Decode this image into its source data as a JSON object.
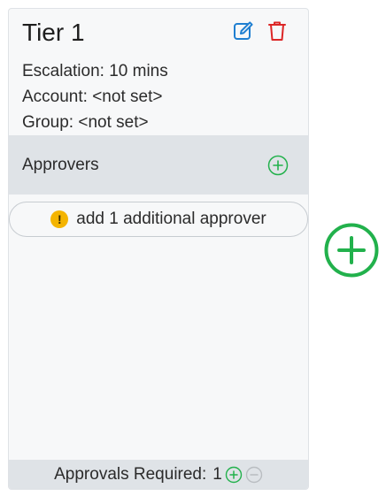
{
  "tier": {
    "title": "Tier 1",
    "escalation": "Escalation: 10 mins",
    "account": "Account: <not set>",
    "group": "Group: <not set>"
  },
  "approvers": {
    "label": "Approvers",
    "placeholder": "add 1 additional approver",
    "warning_glyph": "!"
  },
  "footer": {
    "label": "Approvals Required:",
    "value": "1"
  },
  "icons": {
    "edit": "edit-icon",
    "delete": "trash-icon",
    "add": "plus-circle-icon",
    "remove": "minus-circle-icon",
    "warning": "warning-icon"
  },
  "colors": {
    "edit_blue": "#1f7fd1",
    "delete_red": "#dc2626",
    "add_green": "#22b14c",
    "disabled_gray": "#b9bdc1",
    "warning_yellow": "#f4b400"
  }
}
